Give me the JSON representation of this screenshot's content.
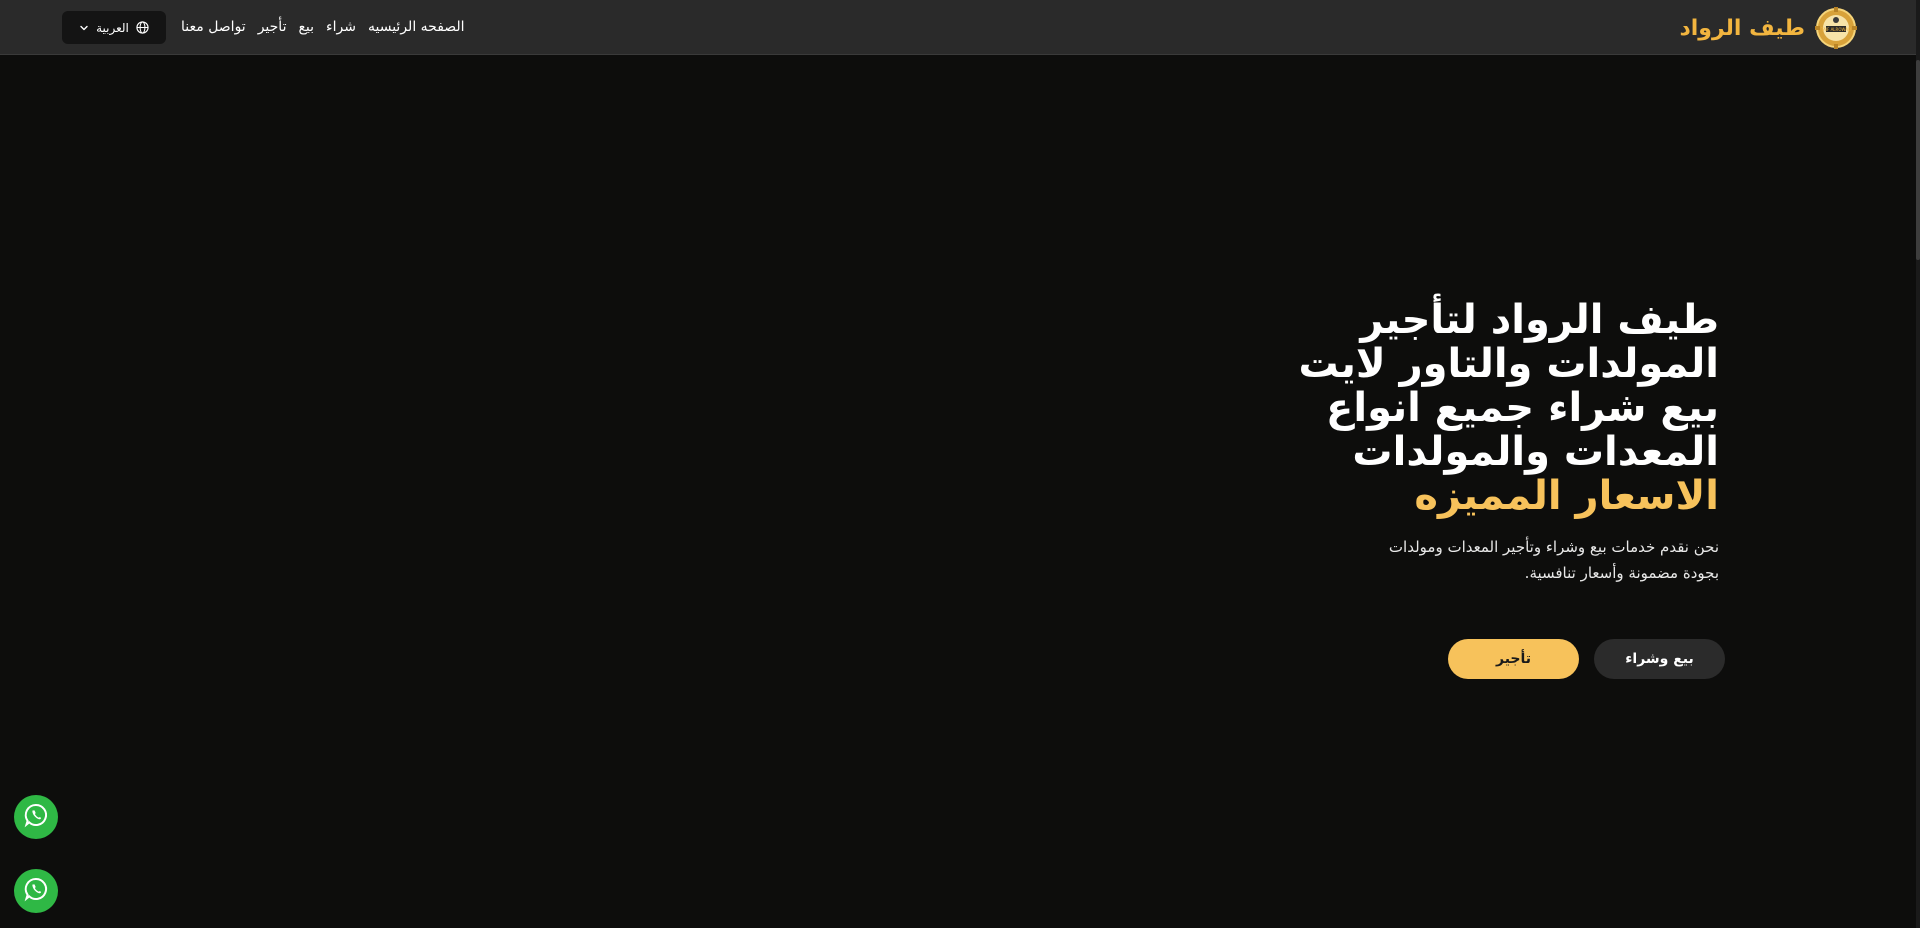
{
  "brand": {
    "name": "طيف الرواد",
    "logo_icon": "gear-badge-logo",
    "logo_text": "TAIF ALROWAD"
  },
  "nav": {
    "items": [
      {
        "label": "الصفحه الرئيسيه"
      },
      {
        "label": "شراء"
      },
      {
        "label": "بيع"
      },
      {
        "label": "تأجير"
      },
      {
        "label": "تواصل معنا"
      }
    ],
    "language": "العربية",
    "language_icon": "globe-icon",
    "dropdown_icon": "chevron-down-icon"
  },
  "hero": {
    "title_lines": [
      "طيف الرواد لتأجير",
      "المولدات والتاور لايت",
      "بيع شراء جميع انواع",
      "المعدات والمولدات"
    ],
    "title_accent": "الاسعار المميزه",
    "description_lines": [
      "نحن نقدم خدمات بيع وشراء وتأجير المعدات ومولدات",
      "بجودة مضمونة وأسعار تنافسية."
    ],
    "buy_sell_label": "بيع وشراء",
    "rent_label": "تأجير"
  },
  "floating": {
    "whatsapp_icon": "whatsapp-icon"
  },
  "colors": {
    "accent": "#f7c25b",
    "brand": "#f2b53f",
    "background": "#0d0d0c",
    "header": "#2a2a2a",
    "whatsapp": "#2fb845"
  }
}
